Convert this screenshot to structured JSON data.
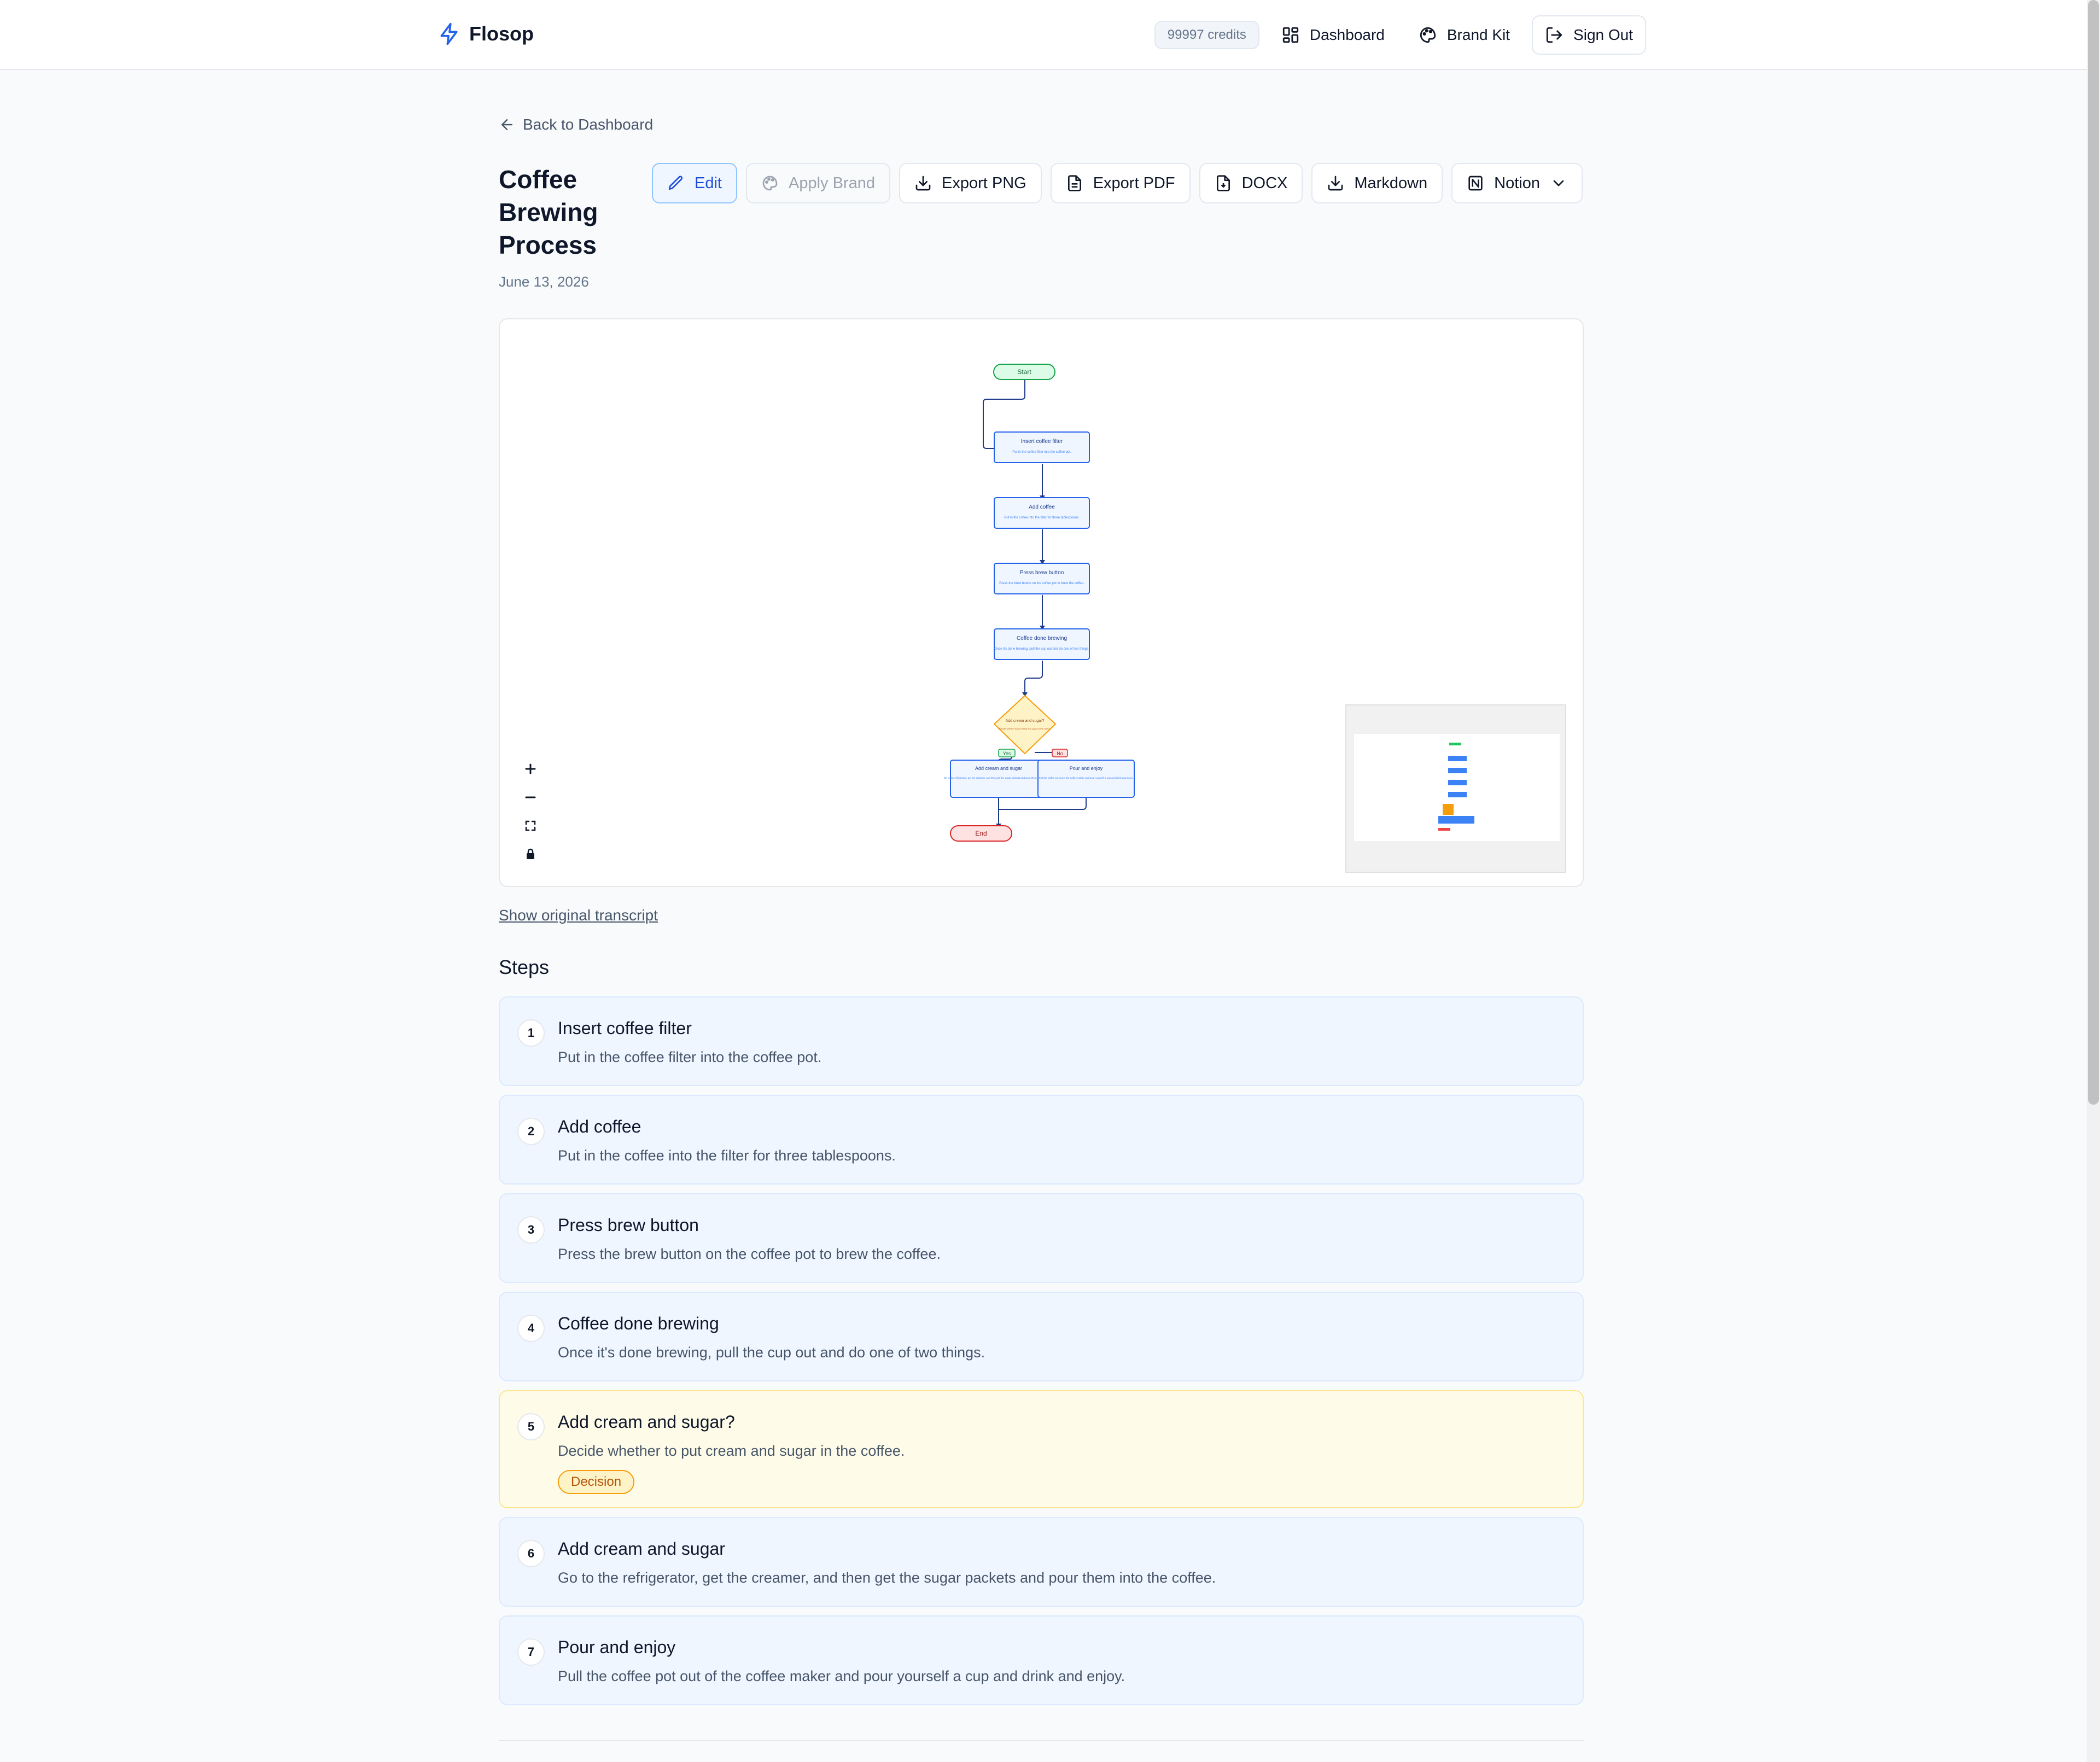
{
  "header": {
    "brand": "Flosop",
    "credits": "99997 credits",
    "nav": {
      "dashboard": "Dashboard",
      "brand_kit": "Brand Kit",
      "sign_out": "Sign Out"
    }
  },
  "back_link": "Back to Dashboard",
  "document": {
    "title": "Coffee Brewing Process",
    "date": "June 13, 2026"
  },
  "toolbar": {
    "edit": "Edit",
    "apply_brand": "Apply Brand",
    "export_png": "Export PNG",
    "export_pdf": "Export PDF",
    "docx": "DOCX",
    "markdown": "Markdown",
    "notion": "Notion"
  },
  "diagram": {
    "start": "Start",
    "end": "End",
    "yes": "Yes",
    "no": "No",
    "nodes": [
      {
        "title": "Insert coffee filter",
        "desc": "Put in the coffee filter into the coffee pot."
      },
      {
        "title": "Add coffee",
        "desc": "Put in the coffee into the filter for three tablespoons."
      },
      {
        "title": "Press brew button",
        "desc": "Press the brew button on the coffee pot to brew the coffee."
      },
      {
        "title": "Coffee done brewing",
        "desc": "Once it's done brewing, pull the cup out and do one of two things."
      }
    ],
    "decision": {
      "title": "Add cream and sugar?",
      "desc": "Decide whether to put cream and sugar in the coffee."
    },
    "branches": [
      {
        "title": "Add cream and sugar",
        "desc": "Go to the refrigerator, get the creamer, and then get the sugar packets and pour them into the coffee."
      },
      {
        "title": "Pour and enjoy",
        "desc": "Pull the coffee pot out of the coffee maker and pour yourself a cup and drink and enjoy."
      }
    ],
    "colors": {
      "terminal_start": "#dcfce7",
      "terminal_end": "#fee2e2",
      "process": "#eff6ff",
      "decision": "#fef3c7",
      "accent": "#2563eb"
    }
  },
  "show_transcript": "Show original transcript",
  "steps_heading": "Steps",
  "steps": [
    {
      "num": "1",
      "title": "Insert coffee filter",
      "desc": "Put in the coffee filter into the coffee pot."
    },
    {
      "num": "2",
      "title": "Add coffee",
      "desc": "Put in the coffee into the filter for three tablespoons."
    },
    {
      "num": "3",
      "title": "Press brew button",
      "desc": "Press the brew button on the coffee pot to brew the coffee."
    },
    {
      "num": "4",
      "title": "Coffee done brewing",
      "desc": "Once it's done brewing, pull the cup out and do one of two things."
    },
    {
      "num": "5",
      "title": "Add cream and sugar?",
      "desc": "Decide whether to put cream and sugar in the coffee.",
      "badge": "Decision"
    },
    {
      "num": "6",
      "title": "Add cream and sugar",
      "desc": "Go to the refrigerator, get the creamer, and then get the sugar packets and pour them into the coffee."
    },
    {
      "num": "7",
      "title": "Pour and enjoy",
      "desc": "Pull the coffee pot out of the coffee maker and pour yourself a cup and drink and enjoy."
    }
  ]
}
